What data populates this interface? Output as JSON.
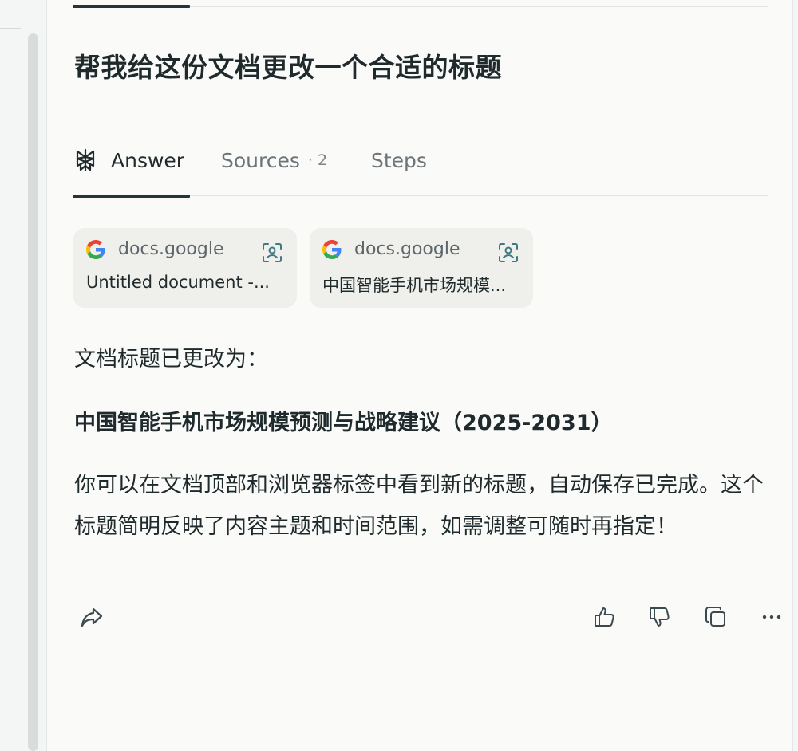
{
  "thread": {
    "question": "帮我给这份文档更改一个合适的标题"
  },
  "tabs": [
    {
      "label": "Answer",
      "icon": "answer-logo-icon"
    },
    {
      "label": "Sources",
      "count": "2"
    },
    {
      "label": "Steps"
    }
  ],
  "sources": [
    {
      "site": "docs.google",
      "title": "Untitled document -...",
      "icon": "google-g-icon"
    },
    {
      "site": "docs.google",
      "title": "中国智能手机市场规模...",
      "icon": "google-g-icon"
    }
  ],
  "answer": {
    "lead": "文档标题已更改为：",
    "new_title": "中国智能手机市场规模预测与战略建议（2025-2031）",
    "body": "你可以在文档顶部和浏览器标签中看到新的标题，自动保存已完成。这个标题简明反映了内容主题和时间范围，如需调整可随时再指定！"
  },
  "actions": [
    {
      "icon": "share-icon"
    },
    {
      "icon": "thumbs-up-icon"
    },
    {
      "icon": "thumbs-down-icon"
    },
    {
      "icon": "copy-icon"
    },
    {
      "icon": "more-icon"
    }
  ],
  "colors": {
    "accent": "#24353b",
    "panel_bg": "#fafaf8",
    "card_bg": "#efefeb",
    "muted_text": "#6b7478"
  }
}
